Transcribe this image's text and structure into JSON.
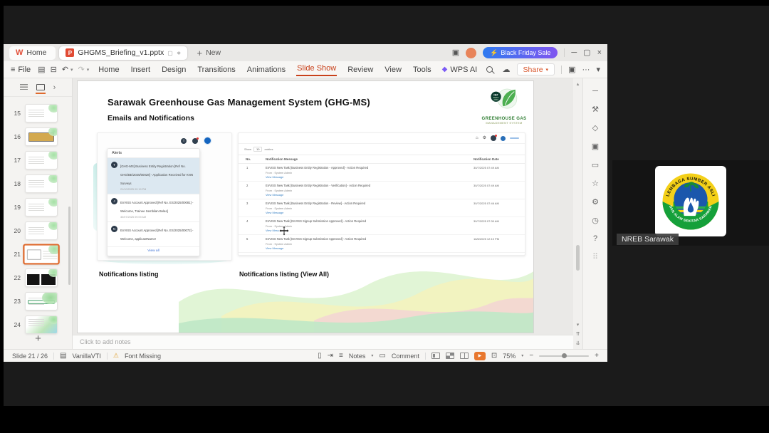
{
  "titlebar": {
    "home_tab": "Home",
    "doc_tab": "GHGMS_Briefing_v1.pptx",
    "new_label": "New",
    "promo_label": "Black Friday Sale"
  },
  "menubar": {
    "file_label": "File",
    "menus": [
      {
        "label": "Home"
      },
      {
        "label": "Insert"
      },
      {
        "label": "Design"
      },
      {
        "label": "Transitions"
      },
      {
        "label": "Animations"
      },
      {
        "label": "Slide Show",
        "active": true
      },
      {
        "label": "Review"
      },
      {
        "label": "View"
      },
      {
        "label": "Tools"
      }
    ],
    "wps_ai_label": "WPS AI",
    "share_label": "Share"
  },
  "sidebar": {
    "slides": [
      {
        "num": "15",
        "variant": "plain"
      },
      {
        "num": "16",
        "variant": "yellowbox"
      },
      {
        "num": "17",
        "variant": "plain"
      },
      {
        "num": "18",
        "variant": "plain"
      },
      {
        "num": "19",
        "variant": "plain"
      },
      {
        "num": "20",
        "variant": "plain"
      },
      {
        "num": "21",
        "variant": "current",
        "selected": true
      },
      {
        "num": "22",
        "variant": "dark"
      },
      {
        "num": "23",
        "variant": "greenbar"
      },
      {
        "num": "24",
        "variant": "greenfull"
      }
    ],
    "add_slide_label": "+"
  },
  "slide": {
    "title": "Sarawak Greenhouse Gas Management System (GHG-MS)",
    "subtitle": "Emails and Notifications",
    "logo": {
      "name": "GREENHOUSE GAS",
      "tagline": "MANAGEMENT SYSTEM",
      "badge": "NET ZERO 2050"
    },
    "alerts_panel": {
      "title": "Alerts",
      "items": [
        {
          "initial": "T",
          "text": "[GHG-MS] Business Entity Registration [Ref No. GHG/BE/2025/00028] - Application Received for KNN Surveys",
          "time": "21/10/2025 02:19 PM",
          "highlight": true
        },
        {
          "initial": "J",
          "text": "EnVISS Account Approved [Ref No. ES/2025/00081] - Welcome, Trainee Sembilan Belas]",
          "time": "30/07/2025 09:09 AM"
        },
        {
          "initial": "N",
          "text": "EnVISS Account Approved [Ref No. ES/2025/00072] - Welcome, applicantName!",
          "time": ""
        }
      ],
      "view_all_label": "View all"
    },
    "portal": {
      "show_label": "Show",
      "show_value": "10",
      "entries_label": "entries",
      "table": {
        "col_no": "No.",
        "col_message": "Notification Message",
        "col_date": "Notification Date",
        "rows": [
          {
            "no": "1",
            "msg": "EnVISS New Task [Business Entity Registration - Approved] - Action Required",
            "from": "From : System Admin",
            "link": "View Message",
            "date": "30/7/2025 07:49 AM"
          },
          {
            "no": "2",
            "msg": "EnVISS New Task [Business Entity Registration - Verification] - Action Required",
            "from": "From : System Admin",
            "link": "View Message",
            "date": "30/7/2025 07:49 AM"
          },
          {
            "no": "3",
            "msg": "EnVISS New Task [Business Entity Registration - Review] - Action Required",
            "from": "From : System Admin",
            "link": "View Message",
            "date": "30/7/2025 07:46 AM"
          },
          {
            "no": "4",
            "msg": "EnVISS New Task [EnVISS Signup Submission Approved] - Action Required",
            "from": "From : System Admin",
            "link": "View Message",
            "date": "30/7/2025 07:30 AM"
          },
          {
            "no": "5",
            "msg": "EnVISS New Task [EnVISS Signup Submission Approved] - Action Required",
            "from": "From : System Admin",
            "link": "View Message",
            "date": "16/6/2025 12:10 PM"
          }
        ]
      }
    },
    "caption_left": "Notifications listing",
    "caption_right": "Notifications listing (View All)"
  },
  "notes_bar": {
    "placeholder": "Click to add notes"
  },
  "statusbar": {
    "slide_indicator": "Slide 21 / 26",
    "theme_name": "VanillaVTI",
    "font_warning": "Font Missing",
    "notes_label": "Notes",
    "comment_label": "Comment",
    "zoom_level": "75%"
  },
  "participant": {
    "name": "NREB Sarawak",
    "logo_text_top": "LEMBAGA SUMBER ASLI",
    "logo_text_bottom": "DAN ALAM SEKITAR SARAWAK"
  },
  "icons": {
    "hamburger": "≡",
    "save": "▤",
    "print": "⊟",
    "undo": "↶",
    "redo": "↷",
    "chevron_down": "▾",
    "chevron_right": "›",
    "cloud": "☁",
    "lightning": "⚡",
    "minimize": "─",
    "maximize": "▢",
    "close": "×",
    "window_stack": "▣",
    "info_i": "i",
    "home": "⌂",
    "gear": "⚙",
    "warning": "⚠",
    "theme": "▤",
    "phone": "▯",
    "export": "⇥",
    "notes_lines": "≡",
    "comment_box": "▭",
    "play": "▶",
    "fit": "⊡",
    "minus": "−",
    "plus": "+",
    "scroll_up": "▴",
    "scroll_down": "▾",
    "prev_slide": "⇈",
    "next_slide": "⇊",
    "rail_collapse": "─",
    "rail_tools": "⚒",
    "rail_ai": "◇",
    "rail_shapes": "▣",
    "rail_comment": "▭",
    "rail_star": "☆",
    "rail_settings": "⚙",
    "rail_history": "◷",
    "rail_help": "?",
    "rail_apps": "⠿",
    "ai_spark": "◆"
  },
  "colors": {
    "accent_orange": "#d6512a",
    "promo_start": "#2f7bf0",
    "promo_end": "#8055f0",
    "link_blue": "#3b82c4",
    "logo_green": "#2e7d32",
    "highlight_row": "#dce8f1",
    "dark_bg": "#1b1b1b"
  }
}
